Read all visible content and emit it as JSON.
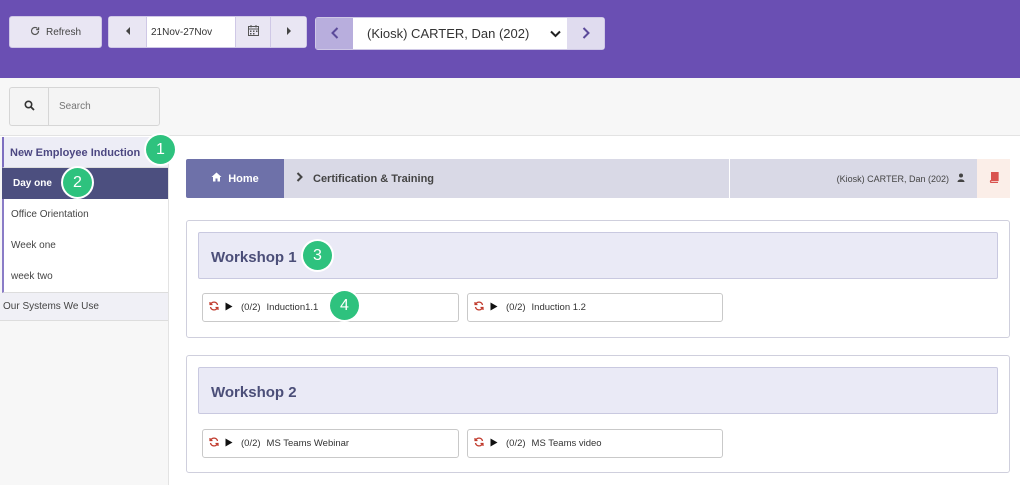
{
  "toolbar": {
    "refresh_label": "Refresh",
    "date_range": "21Nov-27Nov",
    "person_select": "(Kiosk) CARTER, Dan (202)"
  },
  "search": {
    "placeholder": "Search"
  },
  "sidebar": {
    "group_label": "New Employee Induction",
    "items": [
      {
        "label": "Day one",
        "active": true
      },
      {
        "label": "Office Orientation",
        "active": false
      },
      {
        "label": "Week one",
        "active": false
      },
      {
        "label": "week two",
        "active": false
      }
    ],
    "footer_label": "Our Systems We Use"
  },
  "breadcrumb": {
    "home_label": "Home",
    "section_label": "Certification & Training",
    "user_label": "(Kiosk) CARTER, Dan (202)"
  },
  "workshops": [
    {
      "title": "Workshop 1",
      "courses": [
        {
          "progress": "(0/2)",
          "name": "Induction1.1"
        },
        {
          "progress": "(0/2)",
          "name": "Induction 1.2"
        }
      ]
    },
    {
      "title": "Workshop 2",
      "courses": [
        {
          "progress": "(0/2)",
          "name": "MS Teams Webinar"
        },
        {
          "progress": "(0/2)",
          "name": "MS Teams video"
        }
      ]
    }
  ],
  "badges": [
    "1",
    "2",
    "3",
    "4"
  ],
  "colors": {
    "header_purple": "#6a4fb3",
    "active_nav": "#4c4f7f",
    "home_crumb": "#6e71a9",
    "badge_green": "#2ec27e",
    "sync_red": "#c0392b"
  }
}
